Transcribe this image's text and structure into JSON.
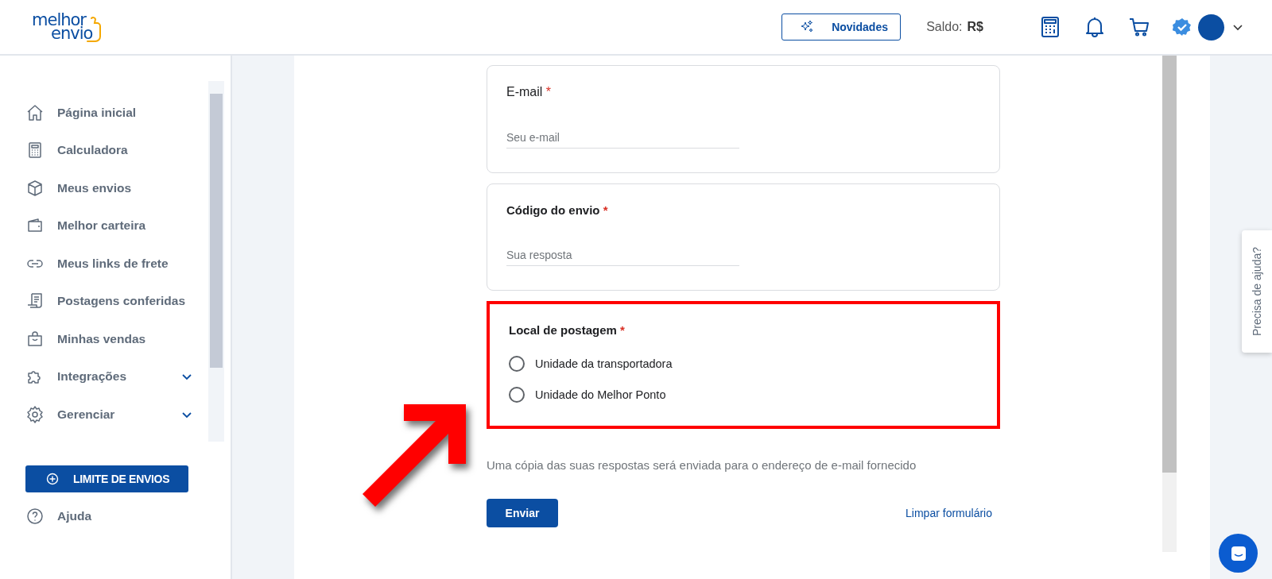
{
  "header": {
    "logo": {
      "line_1": "melhor",
      "line_2": "envio"
    },
    "news_button": "Novidades",
    "balance_label": "Saldo:",
    "balance_value": "R$",
    "verified": true
  },
  "sidebar": {
    "items": [
      {
        "label": "Página inicial",
        "expandable": false
      },
      {
        "label": "Calculadora",
        "expandable": false
      },
      {
        "label": "Meus envios",
        "expandable": false
      },
      {
        "label": "Melhor carteira",
        "expandable": false
      },
      {
        "label": "Meus links de frete",
        "expandable": false
      },
      {
        "label": "Postagens conferidas",
        "expandable": false
      },
      {
        "label": "Minhas vendas",
        "expandable": false
      },
      {
        "label": "Integrações",
        "expandable": true
      },
      {
        "label": "Gerenciar",
        "expandable": true
      }
    ],
    "limit_button": "LIMITE DE ENVIOS",
    "help": "Ajuda"
  },
  "form": {
    "questions": [
      {
        "kind": "text",
        "label": "E-mail",
        "emphasis": false,
        "required_mark": "*",
        "highlighted": false,
        "placeholder": "Seu e-mail"
      },
      {
        "kind": "text",
        "label": "Código do envio",
        "emphasis": true,
        "required_mark": "*",
        "highlighted": false,
        "placeholder": "Sua resposta"
      },
      {
        "kind": "radio",
        "label": "Local de postagem",
        "emphasis": true,
        "required_mark": "*",
        "highlighted": true,
        "options": [
          {
            "label": "Unidade da transportadora",
            "selected": false
          },
          {
            "label": "Unidade do Melhor Ponto",
            "selected": false
          }
        ]
      }
    ],
    "note": "Uma cópia das suas respostas será enviada para o endereço de e-mail fornecido",
    "submit": "Enviar",
    "clear": "Limpar formulário"
  },
  "annotation": {
    "kind": "arrow"
  },
  "help_tab": "Precisa de ajuda?"
}
